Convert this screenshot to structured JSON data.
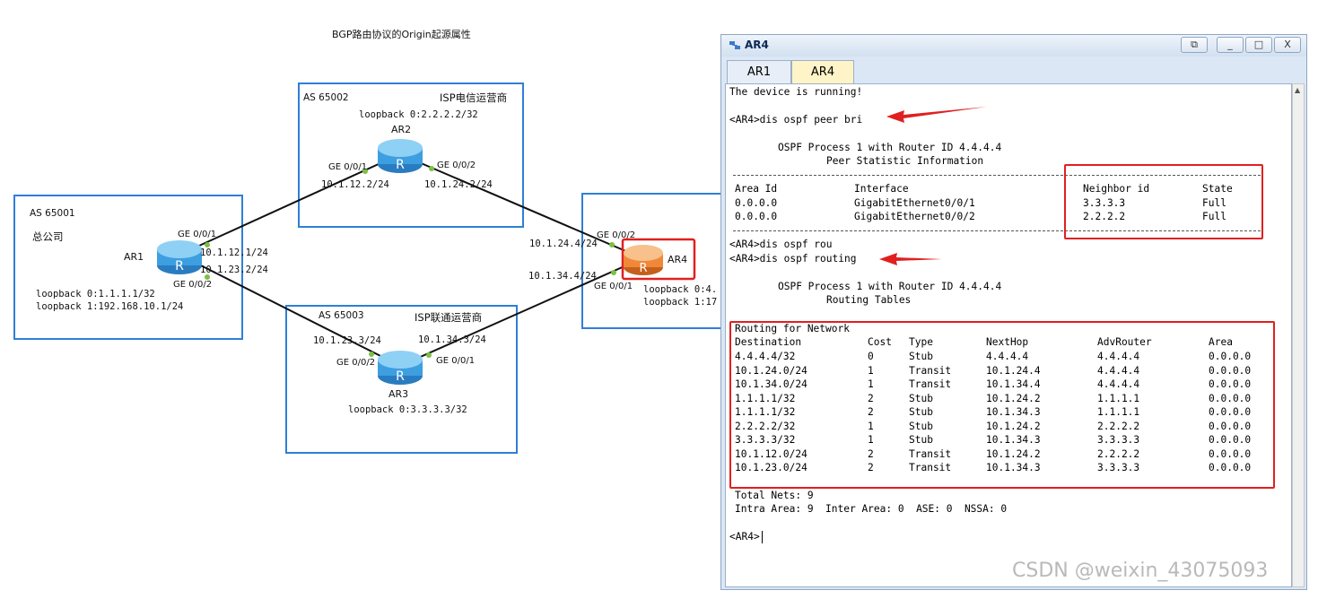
{
  "diagram": {
    "title": "BGP路由协议的Origin起源属性",
    "as_boxes": [
      {
        "label": "AS 65001",
        "name": "总公司"
      },
      {
        "label": "AS 65002",
        "name": "ISP电信运营商"
      },
      {
        "label": "AS 65003",
        "name": "ISP联通运营商"
      },
      {
        "label": "",
        "name": ""
      }
    ],
    "routers": {
      "ar1": {
        "name": "AR1",
        "loopbacks": [
          "loopback 0:1.1.1.1/32",
          "loopback 1:192.168.10.1/24"
        ]
      },
      "ar2": {
        "name": "AR2",
        "loopbacks": [
          "loopback 0:2.2.2.2/32"
        ]
      },
      "ar3": {
        "name": "AR3",
        "loopbacks": [
          "loopback 0:3.3.3.3/32"
        ]
      },
      "ar4": {
        "name": "AR4",
        "loopbacks": [
          "loopback 0:4.",
          "loopback 1:17"
        ]
      }
    },
    "interfaces": {
      "ar1_ge001": "GE 0/0/1",
      "ar1_ip1": "10.1.12.1/24",
      "ar1_ip2": "10.1.23.2/24",
      "ar1_ge002": "GE 0/0/2",
      "ar2_ge001": "GE 0/0/1",
      "ar2_ip1": "10.1.12.2/24",
      "ar2_ge002": "GE 0/0/2",
      "ar2_ip2": "10.1.24.2/24",
      "ar3_ip1": "10.1.23.3/24",
      "ar3_ge002": "GE 0/0/2",
      "ar3_ip2": "10.1.34.3/24",
      "ar3_ge001": "GE 0/0/1",
      "ar4_ge002": "GE 0/0/2",
      "ar4_ip1": "10.1.24.4/24",
      "ar4_ip2": "10.1.34.4/24",
      "ar4_ge001": "GE 0/0/1"
    }
  },
  "window": {
    "title": "AR4",
    "tabs": [
      "AR1",
      "AR4"
    ],
    "active_tab": "AR4",
    "buttons": {
      "restore": "⧉",
      "minimize": "_",
      "maximize": "□",
      "close": "X"
    }
  },
  "terminal": {
    "l_running": "The device is running!",
    "l_cmd1": "<AR4>dis ospf peer bri",
    "l_proc1": "OSPF Process 1 with Router ID 4.4.4.4",
    "l_peer_title": "Peer Statistic Information",
    "peer": {
      "headers": [
        "Area Id",
        "Interface",
        "Neighbor id",
        "State"
      ],
      "rows": [
        [
          "0.0.0.0",
          "GigabitEthernet0/0/1",
          "3.3.3.3",
          "Full"
        ],
        [
          "0.0.0.0",
          "GigabitEthernet0/0/2",
          "2.2.2.2",
          "Full"
        ]
      ]
    },
    "l_cmd2": "<AR4>dis ospf rou",
    "l_cmd3": "<AR4>dis ospf routing",
    "l_proc2": "OSPF Process 1 with Router ID 4.4.4.4",
    "l_rt_title": "Routing Tables",
    "l_rfn": "Routing for Network",
    "routes": {
      "headers": [
        "Destination",
        "Cost",
        "Type",
        "NextHop",
        "AdvRouter",
        "Area"
      ],
      "rows": [
        [
          "4.4.4.4/32",
          "0",
          "Stub",
          "4.4.4.4",
          "4.4.4.4",
          "0.0.0.0"
        ],
        [
          "10.1.24.0/24",
          "1",
          "Transit",
          "10.1.24.4",
          "4.4.4.4",
          "0.0.0.0"
        ],
        [
          "10.1.34.0/24",
          "1",
          "Transit",
          "10.1.34.4",
          "4.4.4.4",
          "0.0.0.0"
        ],
        [
          "1.1.1.1/32",
          "2",
          "Stub",
          "10.1.24.2",
          "1.1.1.1",
          "0.0.0.0"
        ],
        [
          "1.1.1.1/32",
          "2",
          "Stub",
          "10.1.34.3",
          "1.1.1.1",
          "0.0.0.0"
        ],
        [
          "2.2.2.2/32",
          "1",
          "Stub",
          "10.1.24.2",
          "2.2.2.2",
          "0.0.0.0"
        ],
        [
          "3.3.3.3/32",
          "1",
          "Stub",
          "10.1.34.3",
          "3.3.3.3",
          "0.0.0.0"
        ],
        [
          "10.1.12.0/24",
          "2",
          "Transit",
          "10.1.24.2",
          "2.2.2.2",
          "0.0.0.0"
        ],
        [
          "10.1.23.0/24",
          "2",
          "Transit",
          "10.1.34.3",
          "3.3.3.3",
          "0.0.0.0"
        ]
      ]
    },
    "l_total": "Total Nets: 9",
    "l_intra": "Intra Area: 9  Inter Area: 0  ASE: 0  NSSA: 0",
    "l_prompt": "<AR4>"
  },
  "watermark": "CSDN @weixin_43075093",
  "colors": {
    "as_border": "#2f7fd6",
    "highlight": "#e02020",
    "router_blue": "#3d9fe0",
    "router_orange": "#f0883a",
    "link_dot": "#7ac142"
  }
}
